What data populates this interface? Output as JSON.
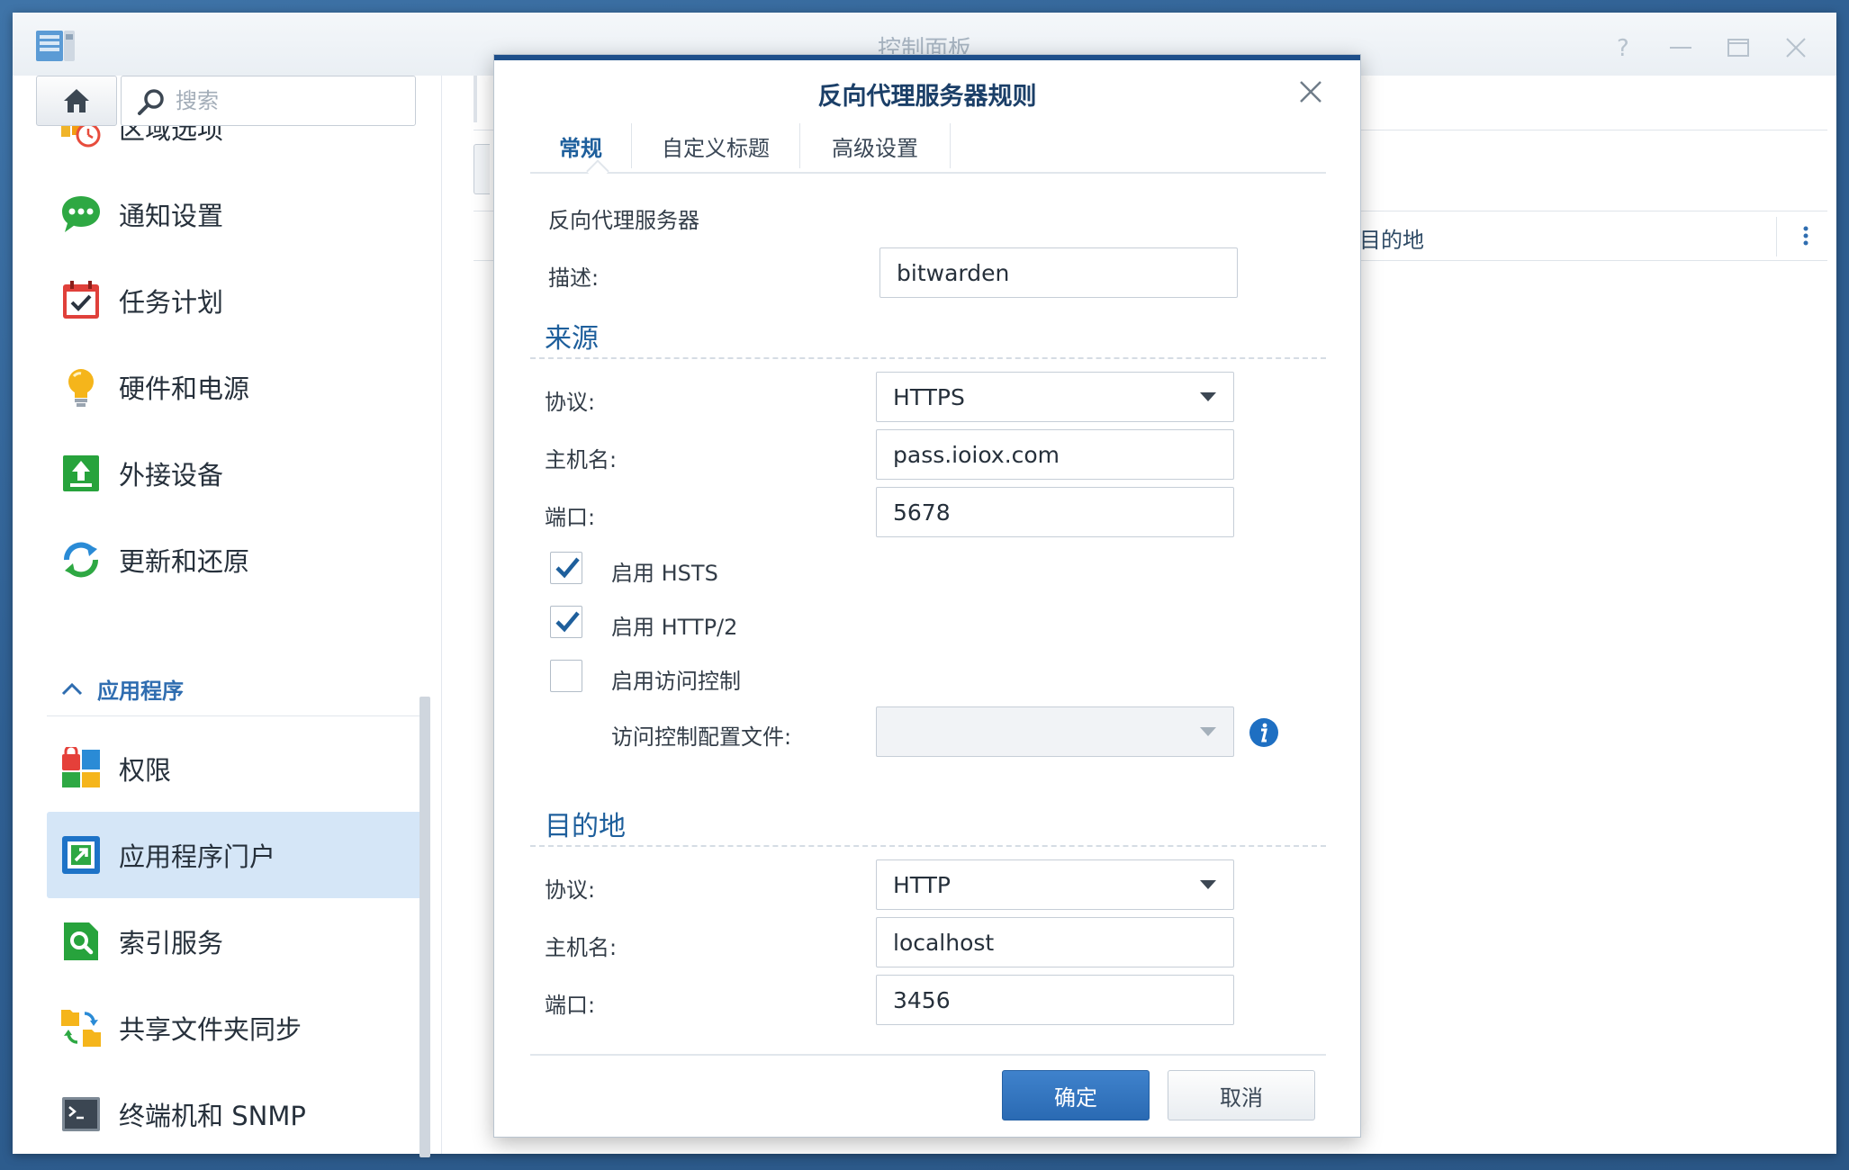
{
  "window": {
    "title": "控制面板"
  },
  "search": {
    "placeholder": "搜索"
  },
  "sidebar": {
    "items": [
      {
        "label": "区域选项",
        "icon": "regional-options-icon"
      },
      {
        "label": "通知设置",
        "icon": "notification-icon"
      },
      {
        "label": "任务计划",
        "icon": "task-scheduler-icon"
      },
      {
        "label": "硬件和电源",
        "icon": "hardware-power-icon"
      },
      {
        "label": "外接设备",
        "icon": "external-devices-icon"
      },
      {
        "label": "更新和还原",
        "icon": "update-restore-icon"
      }
    ],
    "section_label": "应用程序",
    "app_items": [
      {
        "label": "权限",
        "icon": "privileges-icon"
      },
      {
        "label": "应用程序门户",
        "icon": "application-portal-icon",
        "active": true
      },
      {
        "label": "索引服务",
        "icon": "indexing-service-icon"
      },
      {
        "label": "共享文件夹同步",
        "icon": "shared-folder-sync-icon"
      },
      {
        "label": "终端机和 SNMP",
        "icon": "terminal-snmp-icon"
      }
    ]
  },
  "main": {
    "grid_column_destination": "目的地"
  },
  "dialog": {
    "title": "反向代理服务器规则",
    "tabs": [
      "常规",
      "自定义标题",
      "高级设置"
    ],
    "active_tab": "常规",
    "group_label": "反向代理服务器",
    "description_label": "描述:",
    "description_value": "bitwarden",
    "source": {
      "title": "来源",
      "protocol_label": "协议:",
      "protocol_value": "HTTPS",
      "hostname_label": "主机名:",
      "hostname_value": "pass.ioiox.com",
      "port_label": "端口:",
      "port_value": "5678",
      "hsts_label": "启用 HSTS",
      "hsts_checked": true,
      "http2_label": "启用 HTTP/2",
      "http2_checked": true,
      "access_control_label": "启用访问控制",
      "access_control_checked": false,
      "access_profile_label": "访问控制配置文件:",
      "access_profile_value": ""
    },
    "destination": {
      "title": "目的地",
      "protocol_label": "协议:",
      "protocol_value": "HTTP",
      "hostname_label": "主机名:",
      "hostname_value": "localhost",
      "port_label": "端口:",
      "port_value": "3456"
    },
    "ok_label": "确定",
    "cancel_label": "取消"
  },
  "colors": {
    "accent": "#1e5f9c",
    "primary_button": "#3478c1",
    "active_sidebar": "#d5e6f7",
    "dialog_topbar": "#1e4f8a"
  }
}
